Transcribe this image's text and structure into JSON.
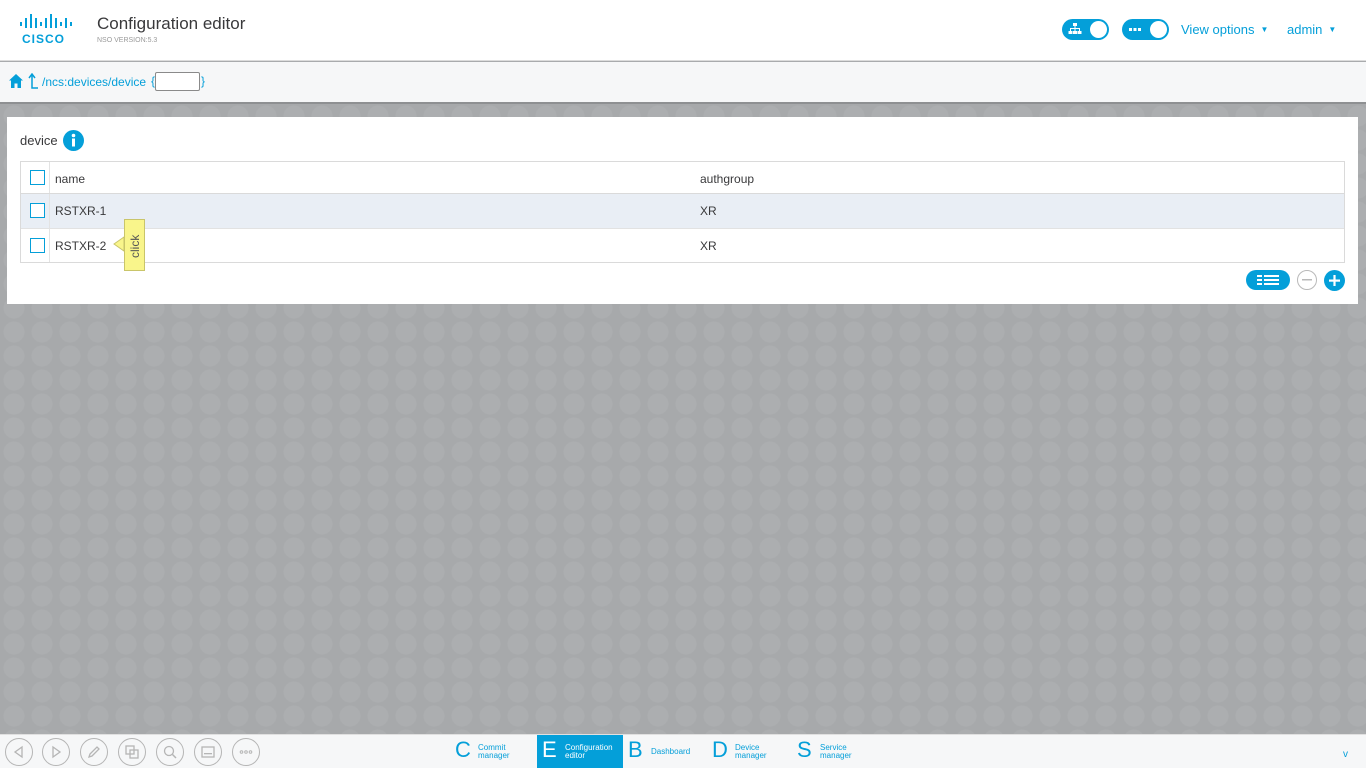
{
  "header": {
    "brand": "CISCO",
    "title": "Configuration editor",
    "version": "NSO VERSION:5.3",
    "view_options_label": "View options",
    "user_label": "admin"
  },
  "breadcrumb": {
    "path": "/ncs:devices/device",
    "open_brace": "{",
    "close_brace": "}",
    "key_value": ""
  },
  "panel": {
    "title": "device",
    "columns": [
      "name",
      "authgroup"
    ],
    "rows": [
      {
        "name": "RSTXR-1",
        "authgroup": "XR"
      },
      {
        "name": "RSTXR-2",
        "authgroup": "XR"
      }
    ],
    "tooltip": "click"
  },
  "bottom_tabs": [
    {
      "letter": "C",
      "line1": "Commit",
      "line2": "manager"
    },
    {
      "letter": "E",
      "line1": "Configuration",
      "line2": "editor"
    },
    {
      "letter": "B",
      "line1": "Dashboard",
      "line2": ""
    },
    {
      "letter": "D",
      "line1": "Device",
      "line2": "manager"
    },
    {
      "letter": "S",
      "line1": "Service",
      "line2": "manager"
    }
  ],
  "bottom_caret": "v",
  "colors": {
    "accent": "#049fd9",
    "background": "#a9abad",
    "tooltip": "#f9f58b"
  }
}
